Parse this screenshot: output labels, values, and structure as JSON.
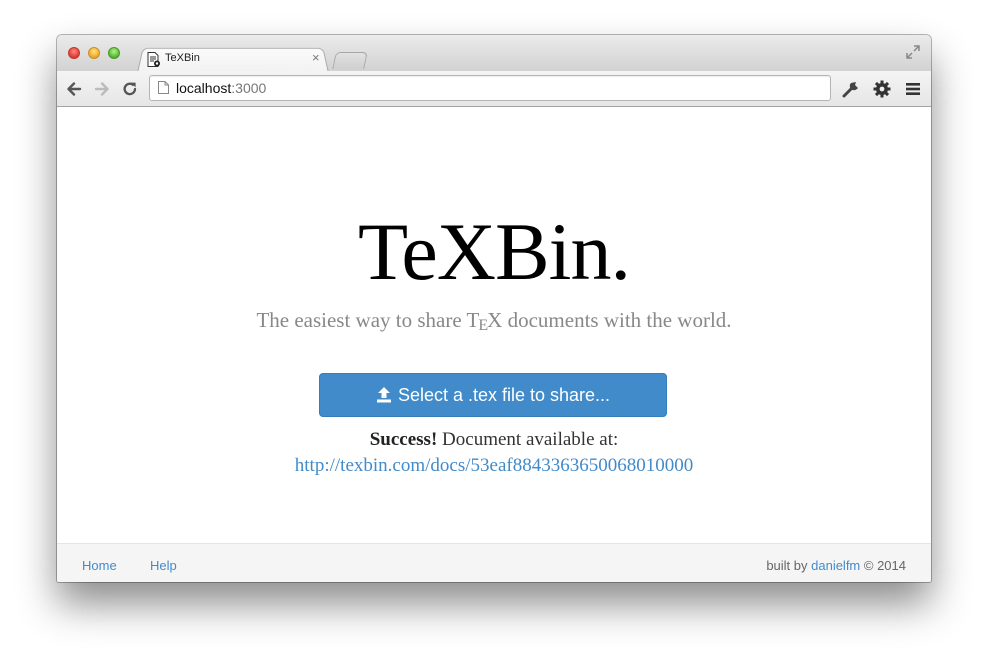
{
  "browser": {
    "tab": {
      "title": "TeXBin"
    },
    "address": {
      "host": "localhost",
      "port": ":3000"
    }
  },
  "page": {
    "title": "TeXBin.",
    "tagline": {
      "before": "The easiest way to share T",
      "e": "E",
      "after": "X documents with the world."
    },
    "upload_button": {
      "label": "Select a .tex file to share..."
    },
    "success": {
      "strong": "Success!",
      "message": " Document available at:",
      "link": "http://texbin.com/docs/53eaf8843363650068010000"
    }
  },
  "footer": {
    "links": [
      "Home",
      "Help"
    ],
    "credit_prefix": "built by ",
    "credit_author": "danielfm",
    "credit_suffix": " © 2014"
  },
  "colors": {
    "link": "#428bca",
    "button": "#428bca"
  }
}
